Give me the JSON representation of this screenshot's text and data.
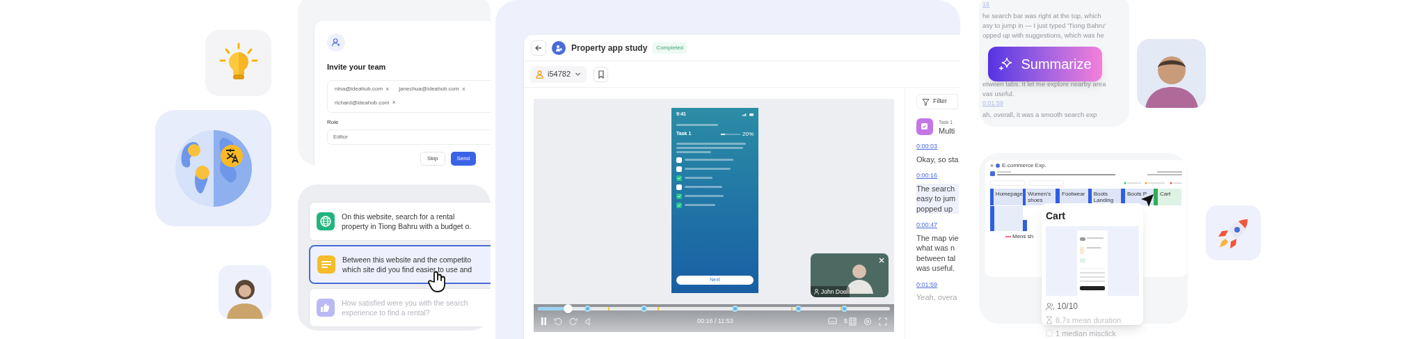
{
  "invite": {
    "title": "Invite your team",
    "emails": [
      {
        "address": "nina@ideahub.com",
        "remove": "×"
      },
      {
        "address": "janechua@ideahub.com",
        "remove": "×"
      },
      {
        "address": "richard@ideahub.com",
        "remove": "×"
      }
    ],
    "role_label": "Role",
    "role_value": "Editor",
    "skip": "Skip",
    "send": "Send"
  },
  "tasks": [
    {
      "kind": "website",
      "lines": [
        "On this website, search for a rental",
        "property in Tiong Bahru with a budget o."
      ],
      "selected": false
    },
    {
      "kind": "text",
      "lines": [
        "Between this website and the competito",
        "which site did you find easier to use and"
      ],
      "selected": true
    },
    {
      "kind": "rating",
      "lines": [
        "How satisfied were you with the search",
        "experience to find a rental?"
      ],
      "selected": false
    }
  ],
  "study": {
    "title": "Property app study",
    "status": "Completed",
    "participant": "i54782",
    "phone": {
      "time": "9:41",
      "task": "Task 1",
      "progress_label": "20%",
      "level": 0.2,
      "options": [
        {
          "checked": false
        },
        {
          "checked": false
        },
        {
          "checked": true
        },
        {
          "checked": false
        },
        {
          "checked": true
        },
        {
          "checked": true
        }
      ],
      "next": "Next"
    },
    "pip_name": "John Doe",
    "player": {
      "level": 0.085,
      "time": "00:16 / 11:53",
      "speed": "5"
    },
    "filter": "Filter",
    "task": {
      "label": "Task 1",
      "title": "Multi"
    },
    "transcript": [
      {
        "time": "0:00:03",
        "lines": [
          "Okay, so sta"
        ],
        "highlighted": false
      },
      {
        "time": "0:00:16",
        "lines": [
          "The search",
          "easy to jum",
          "popped up"
        ],
        "highlighted": true
      },
      {
        "time": "0:00:47",
        "lines": [
          "The map vie",
          "what was n",
          "between tal",
          "was useful."
        ],
        "highlighted": false
      },
      {
        "time": "0:01:59",
        "lines": [
          "Yeah, overa"
        ],
        "highlighted": false
      }
    ]
  },
  "summary": {
    "lines": [
      {
        "kind": "time",
        "text": "16"
      },
      {
        "kind": "text",
        "text": "he search bar was right at the top, which"
      },
      {
        "kind": "text",
        "text": "asy to jump in — I just typed 'Tiong Bahru'"
      },
      {
        "kind": "text",
        "text": "opped up with suggestions, which was he"
      },
      {
        "kind": "gap"
      },
      {
        "kind": "text",
        "text": "etween tabs. It let me explore nearby area"
      },
      {
        "kind": "text",
        "text": "vas useful."
      },
      {
        "kind": "time",
        "text": "0:01:59"
      },
      {
        "kind": "text",
        "text": "ah, overall, it was a smooth search exp"
      }
    ],
    "button": "Summarize"
  },
  "journey": {
    "title": "E-commerce Exp.",
    "nodes": [
      {
        "label": "Homepage",
        "kind": "step"
      },
      {
        "label": "Women's shoes",
        "kind": "step"
      },
      {
        "label": "Footwear",
        "kind": "step"
      },
      {
        "label": "Boots Landing",
        "kind": "step"
      },
      {
        "label": "Boots P",
        "kind": "step"
      },
      {
        "label": "Cart",
        "kind": "goal"
      }
    ],
    "branch": "Mens sh",
    "popup": {
      "title": "Cart",
      "count": "10/10",
      "duration": "8.7s mean duration",
      "misclicks": "1 median misclick"
    }
  }
}
